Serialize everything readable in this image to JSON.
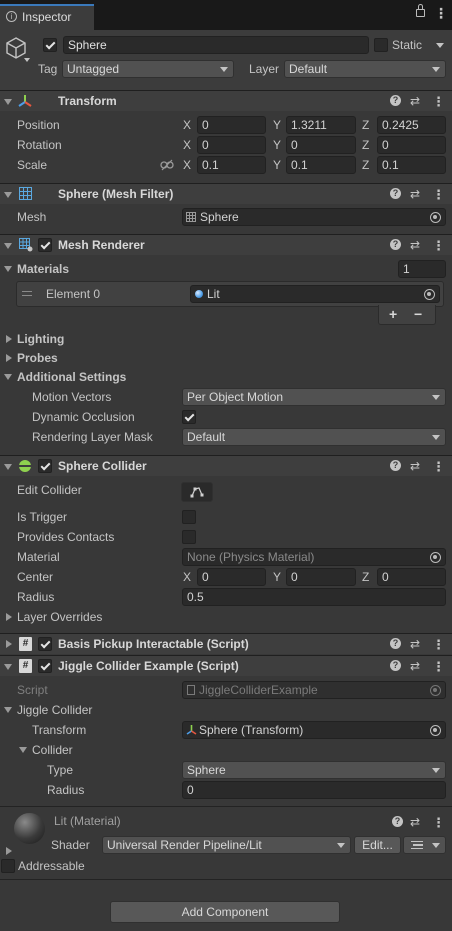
{
  "tab": {
    "title": "Inspector"
  },
  "object": {
    "name": "Sphere",
    "static_label": "Static",
    "tag_label": "Tag",
    "tag_value": "Untagged",
    "layer_label": "Layer",
    "layer_value": "Default"
  },
  "transform": {
    "title": "Transform",
    "rows": [
      {
        "label": "Position",
        "x": "0",
        "y": "1.3211",
        "z": "0.2425"
      },
      {
        "label": "Rotation",
        "x": "0",
        "y": "0",
        "z": "0"
      },
      {
        "label": "Scale",
        "x": "0.1",
        "y": "0.1",
        "z": "0.1"
      }
    ],
    "axes": {
      "x": "X",
      "y": "Y",
      "z": "Z"
    }
  },
  "mesh_filter": {
    "title": "Sphere (Mesh Filter)",
    "mesh_label": "Mesh",
    "mesh_value": "Sphere"
  },
  "mesh_renderer": {
    "title": "Mesh Renderer",
    "materials_label": "Materials",
    "materials_count": "1",
    "element_label": "Element 0",
    "element_value": "Lit",
    "add_btn": "+",
    "remove_btn": "−",
    "lighting_label": "Lighting",
    "probes_label": "Probes",
    "additional_label": "Additional Settings",
    "motion_vectors_label": "Motion Vectors",
    "motion_vectors_value": "Per Object Motion",
    "dynamic_occlusion_label": "Dynamic Occlusion",
    "rendering_layer_label": "Rendering Layer Mask",
    "rendering_layer_value": "Default"
  },
  "sphere_collider": {
    "title": "Sphere Collider",
    "edit_label": "Edit Collider",
    "is_trigger_label": "Is Trigger",
    "provides_contacts_label": "Provides Contacts",
    "material_label": "Material",
    "material_value": "None (Physics Material)",
    "center_label": "Center",
    "center": {
      "x": "0",
      "y": "0",
      "z": "0"
    },
    "radius_label": "Radius",
    "radius_value": "0.5",
    "layer_overrides_label": "Layer Overrides"
  },
  "basis_pickup": {
    "title": "Basis Pickup Interactable (Script)"
  },
  "jiggle": {
    "title": "Jiggle Collider Example (Script)",
    "script_label": "Script",
    "script_value": "JiggleColliderExample",
    "jiggle_collider_label": "Jiggle Collider",
    "transform_label": "Transform",
    "transform_value": "Sphere (Transform)",
    "collider_label": "Collider",
    "type_label": "Type",
    "type_value": "Sphere",
    "radius_label": "Radius",
    "radius_value": "0"
  },
  "material": {
    "title": "Lit (Material)",
    "shader_label": "Shader",
    "shader_value": "Universal Render Pipeline/Lit",
    "edit_btn": "Edit...",
    "addressable_label": "Addressable"
  },
  "add_component_btn": "Add Component",
  "colors": {
    "bg": "#383838",
    "header": "#3e3e3e",
    "field": "#2a2a2a",
    "accent": "#4d9ee8",
    "collider_green": "#8fd14f"
  }
}
